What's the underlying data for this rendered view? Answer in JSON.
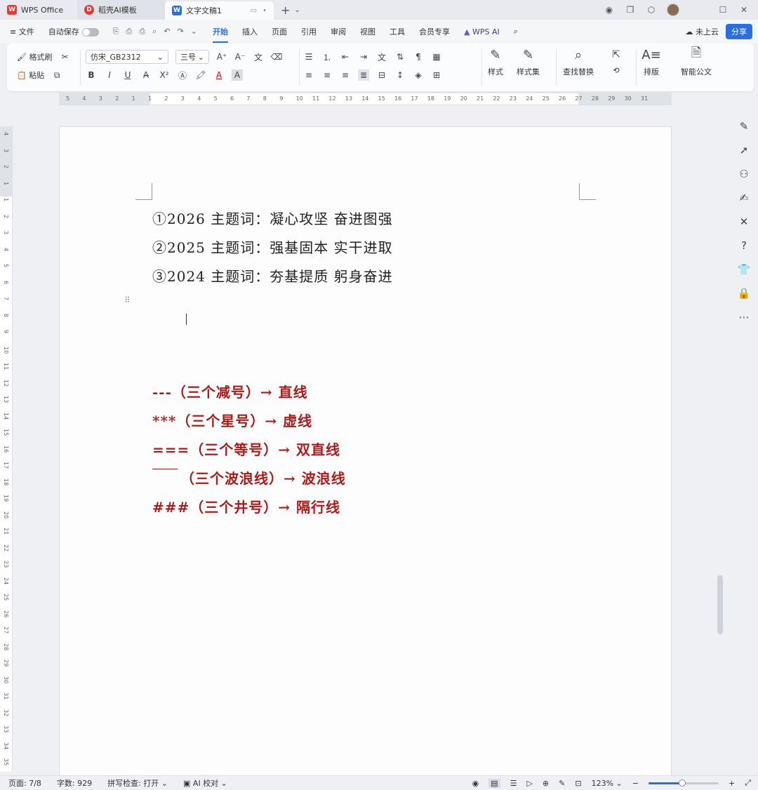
{
  "tabs": {
    "home": "WPS Office",
    "templates": "稻壳AI模板",
    "doc": "文字文稿1"
  },
  "menu": {
    "file": "文件",
    "autosave": "自动保存",
    "items": [
      "开始",
      "插入",
      "页面",
      "引用",
      "审阅",
      "视图",
      "工具",
      "会员专享",
      "WPS AI"
    ],
    "cloud": "未上云",
    "share": "分享"
  },
  "ribbon": {
    "format_painter": "格式刷",
    "paste": "粘贴",
    "font": "仿宋_GB2312",
    "size": "三号",
    "styles": "样式",
    "style_set": "样式集",
    "find_replace": "查找替换",
    "layout": "排版",
    "smart_doc": "智能公文"
  },
  "ruler": {
    "h_ticks": [
      "5",
      "4",
      "3",
      "2",
      "1",
      "1",
      "2",
      "3",
      "4",
      "5",
      "6",
      "7",
      "8",
      "9",
      "10",
      "11",
      "12",
      "13",
      "14",
      "15",
      "16",
      "17",
      "18",
      "19",
      "20",
      "21",
      "22",
      "23",
      "24",
      "25",
      "26",
      "27",
      "28",
      "29",
      "30",
      "31"
    ],
    "v_ticks": [
      "4",
      "3",
      "2",
      "1",
      "1",
      "2",
      "3",
      "4",
      "5",
      "6",
      "7",
      "8",
      "9",
      "10",
      "11",
      "12",
      "13",
      "14",
      "15",
      "16",
      "17",
      "18",
      "19",
      "20",
      "21",
      "22",
      "23",
      "24",
      "25",
      "26",
      "27",
      "28",
      "29",
      "30",
      "31",
      "32",
      "33",
      "34",
      "35"
    ]
  },
  "document": {
    "themes": [
      "①2026 主题词：凝心攻坚 奋进图强",
      "②2025 主题词：强基固本 实干进取",
      "③2024 主题词：夯基提质 躬身奋进"
    ],
    "shortcuts": [
      {
        "symbol": "---",
        "desc": "（三个减号）→ 直线"
      },
      {
        "symbol": "***",
        "desc": "（三个星号）→ 虚线"
      },
      {
        "symbol": "===",
        "desc": "（三个等号）→ 双直线"
      },
      {
        "symbol": "",
        "desc": "（三个波浪线）→ 波浪线"
      },
      {
        "symbol": "###",
        "desc": "（三个井号）→ 隔行线"
      }
    ]
  },
  "status": {
    "page": "页面: 7/8",
    "words": "字数: 929",
    "spell": "拼写检查: 打开",
    "ai_check": "AI 校对",
    "zoom": "123%",
    "zoom_level": 0.48
  },
  "colors": {
    "accent": "#2b6fdf",
    "red_text": "#a81c1c"
  }
}
